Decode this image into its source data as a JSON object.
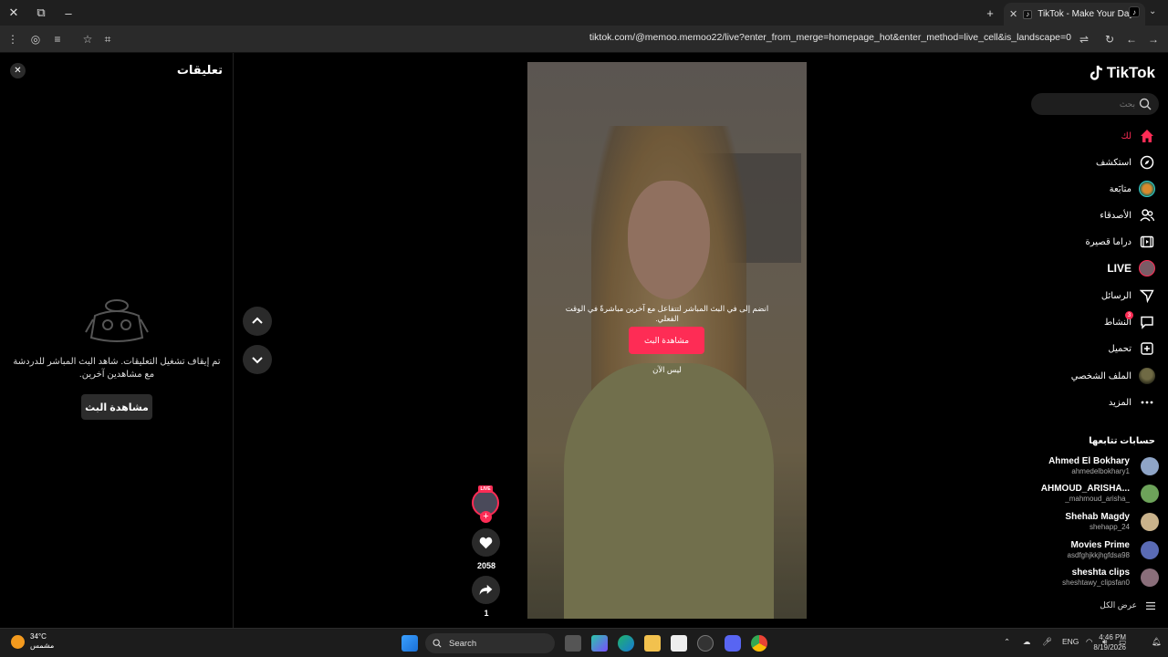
{
  "browser": {
    "tab_title": "TikTok - Make Your Day",
    "url": "tiktok.com/@memoo.memoo22/live?enter_from_merge=homepage_hot&enter_method=live_cell&is_landscape=0"
  },
  "comments_panel": {
    "title": "تعليقات",
    "off_message": "تم إيقاف تشغيل التعليقات. شاهد البث المباشر للدردشة مع مشاهدين آخرين.",
    "watch_button": "مشاهدة البث"
  },
  "video": {
    "message": "انضم إلى في البث المباشر لتتفاعل مع آخرين مباشرةً في الوقت الفعلي.",
    "watch_button": "مشاهدة البث",
    "not_now": "ليس الآن",
    "live_badge": "LIVE",
    "likes": "2058",
    "shares": "1"
  },
  "sidebar": {
    "logo": "TikTok",
    "search_placeholder": "بحث",
    "nav": [
      {
        "label": "لك",
        "icon": "home-icon"
      },
      {
        "label": "استكشف",
        "icon": "compass-icon"
      },
      {
        "label": "متابَعة",
        "icon": "following-avatar-icon"
      },
      {
        "label": "الأصدقاء",
        "icon": "friends-icon"
      },
      {
        "label": "دراما قصيرة",
        "icon": "drama-icon"
      },
      {
        "label": "LIVE",
        "icon": "live-icon"
      },
      {
        "label": "الرسائل",
        "icon": "messages-icon"
      },
      {
        "label": "النشاط",
        "icon": "activity-icon"
      },
      {
        "label": "تحميل",
        "icon": "upload-icon"
      },
      {
        "label": "الملف الشخصي",
        "icon": "profile-icon"
      },
      {
        "label": "المزيد",
        "icon": "more-icon"
      }
    ],
    "activity_badge": "3",
    "following_title": "حسابات تتابعها",
    "accounts": [
      {
        "name": "Ahmed El Bokhary",
        "handle": "ahmedelbokhary1",
        "color": "#8fa5c7"
      },
      {
        "name": "AHMOUD_ARISHA...",
        "handle": "_mahmoud_arisha_",
        "color": "#6da35a"
      },
      {
        "name": "Shehab Magdy",
        "handle": "shehapp_24",
        "color": "#c9b28b"
      },
      {
        "name": "Movies Prime",
        "handle": "asdfghjkkjhgfdsa98",
        "color": "#5a6bb5"
      },
      {
        "name": "sheshta clips",
        "handle": "sheshtawy_clipsfan0",
        "color": "#8a6e7a"
      }
    ],
    "see_all": "عرض الكل"
  },
  "taskbar": {
    "temp": "34°C",
    "weather": "مشمس",
    "search": "Search",
    "lang": "ENG",
    "time": "4:46 PM",
    "date": "8/19/2026"
  },
  "colors": {
    "accent": "#fe2c55",
    "bg": "#000000"
  }
}
